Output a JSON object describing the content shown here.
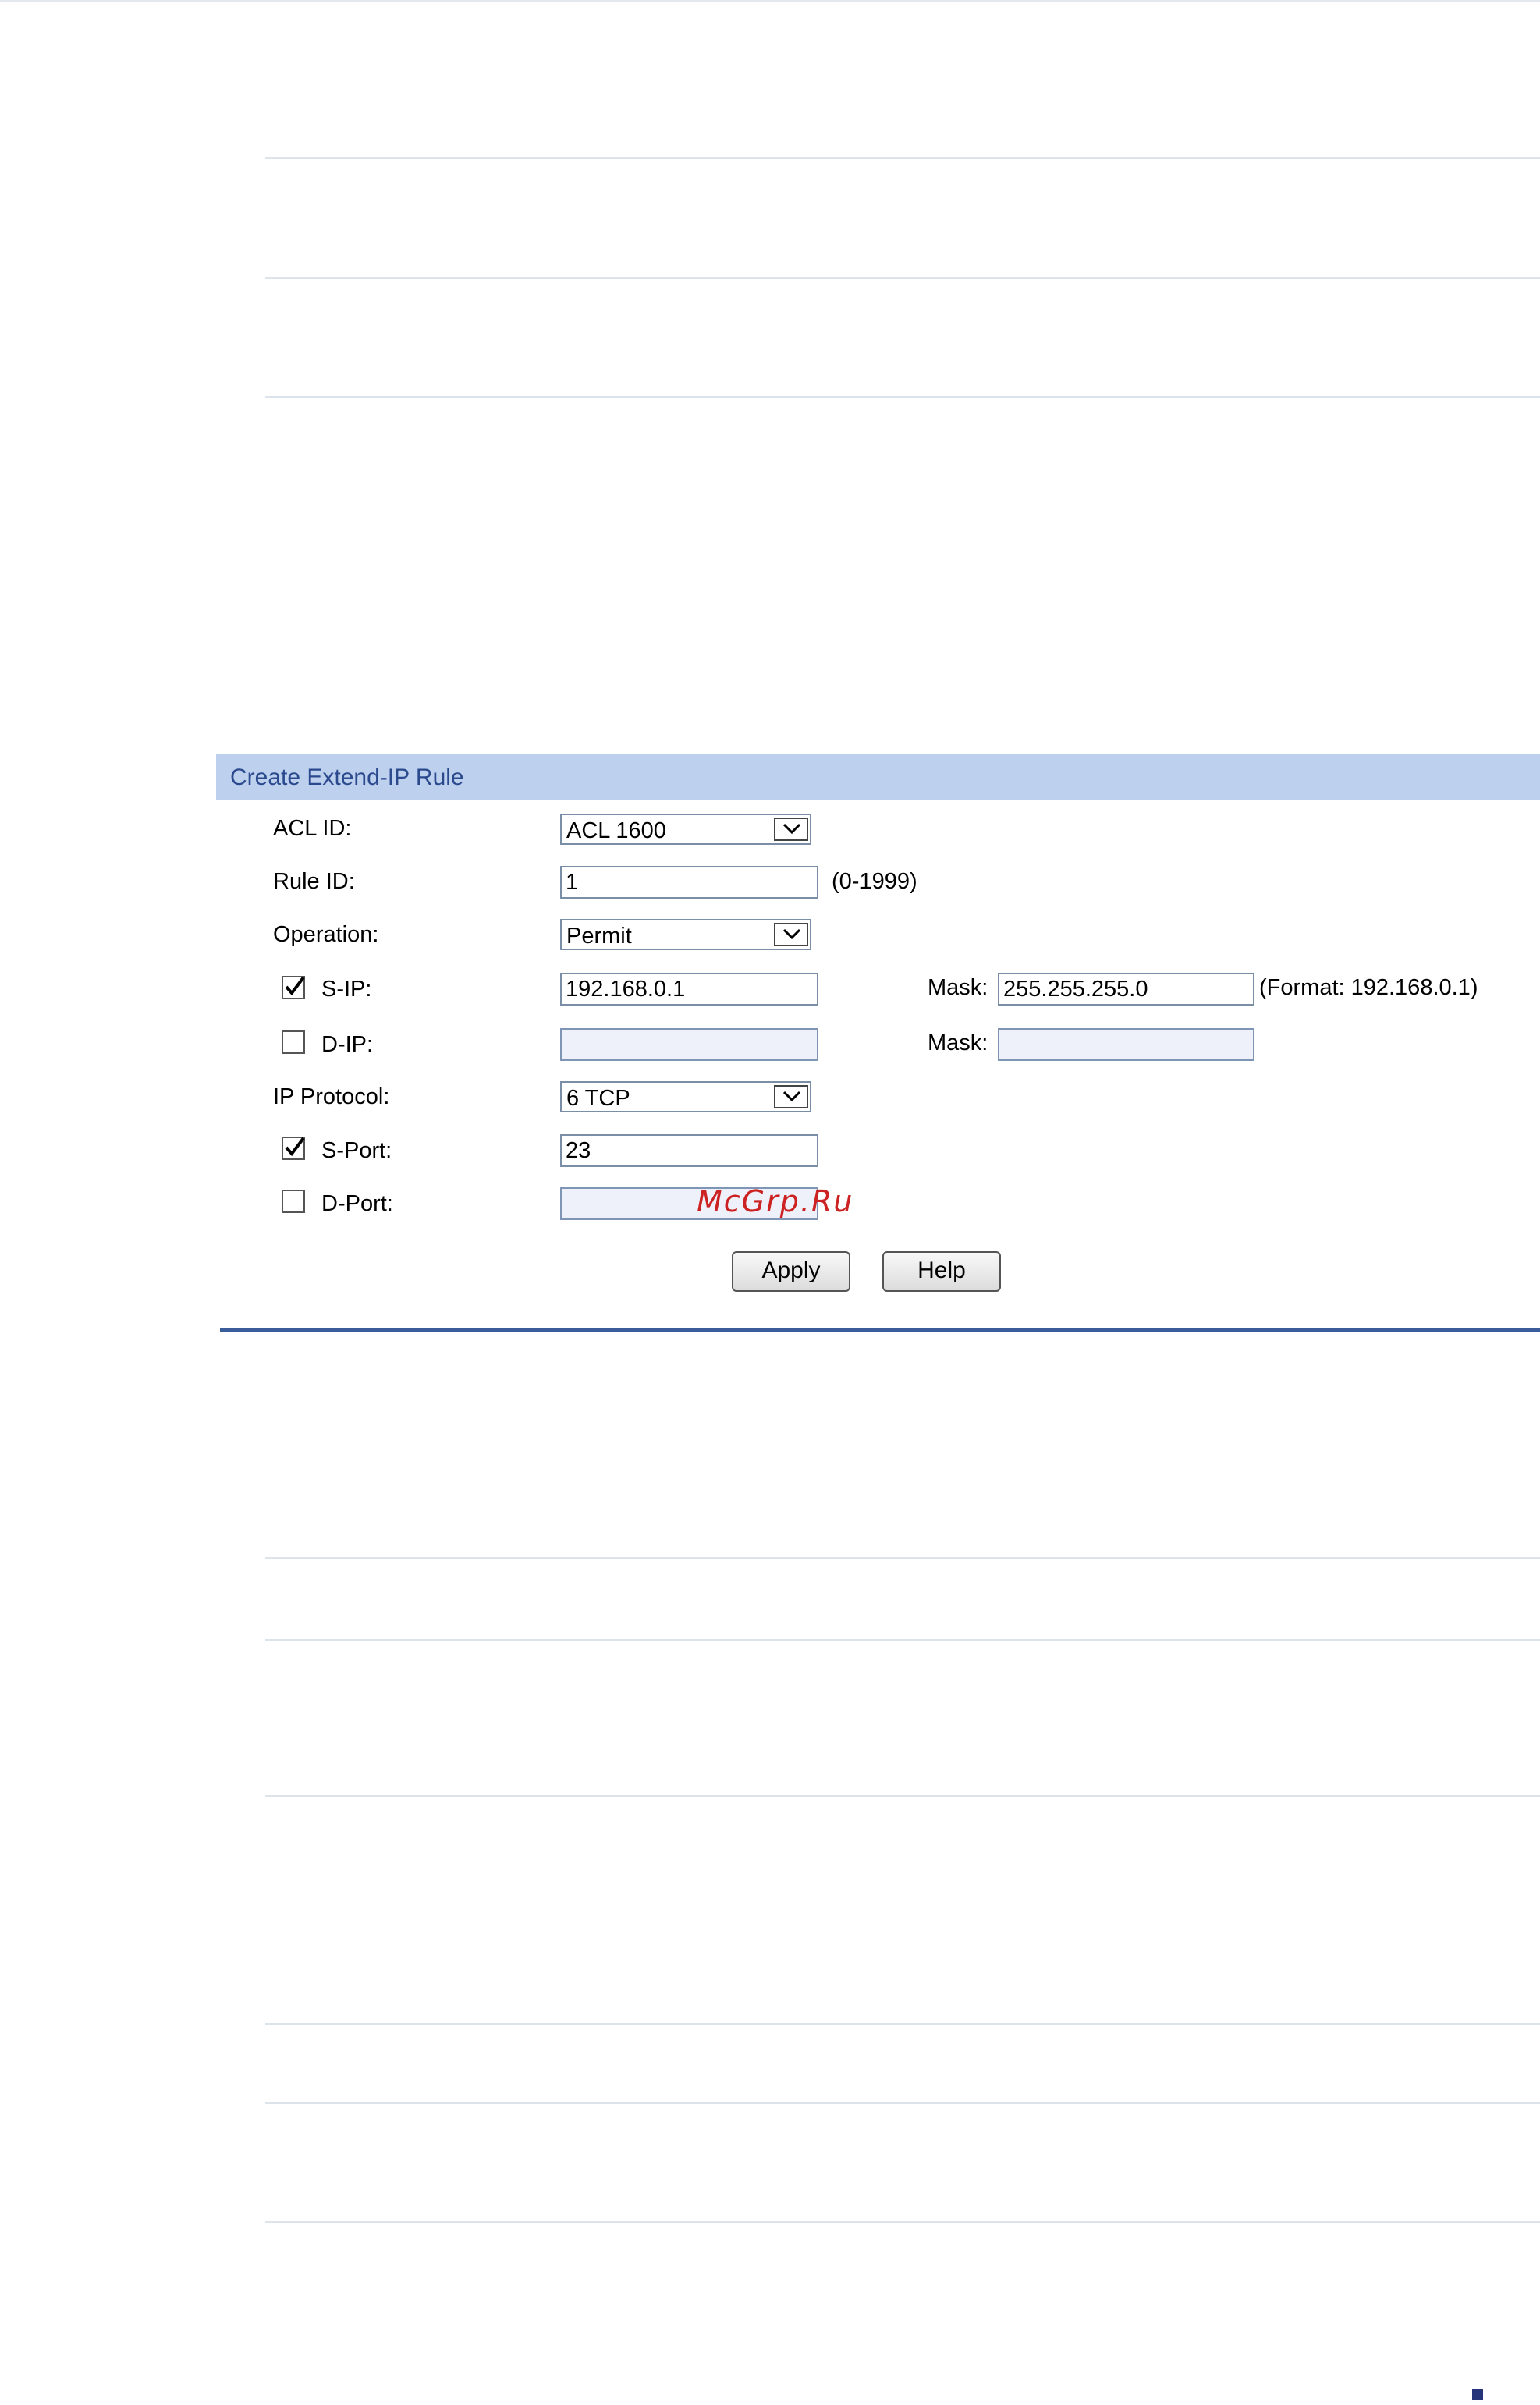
{
  "panel": {
    "title": "Create Extend-IP Rule"
  },
  "form": {
    "acl_id": {
      "label": "ACL ID:",
      "value": "ACL 1600"
    },
    "rule_id": {
      "label": "Rule ID:",
      "value": "1",
      "hint": "(0-1999)"
    },
    "operation": {
      "label": "Operation:",
      "value": "Permit"
    },
    "s_ip": {
      "label": "S-IP:",
      "checked": true,
      "value": "192.168.0.1",
      "mask_label": "Mask:",
      "mask_value": "255.255.255.0",
      "format_hint": "(Format: 192.168.0.1)"
    },
    "d_ip": {
      "label": "D-IP:",
      "checked": false,
      "value": "",
      "mask_label": "Mask:",
      "mask_value": ""
    },
    "ip_protocol": {
      "label": "IP Protocol:",
      "value": "6 TCP"
    },
    "s_port": {
      "label": "S-Port:",
      "checked": true,
      "value": "23"
    },
    "d_port": {
      "label": "D-Port:",
      "checked": false,
      "value": ""
    }
  },
  "buttons": {
    "apply": "Apply",
    "help": "Help"
  },
  "watermark": "McGrp.Ru",
  "colors": {
    "panel_header": "#bdd0ee",
    "panel_title": "#2b4a8e",
    "panel_rule": "#3b5d9b",
    "disabled_input": "#eef0fa",
    "watermark": "#cc2222"
  }
}
